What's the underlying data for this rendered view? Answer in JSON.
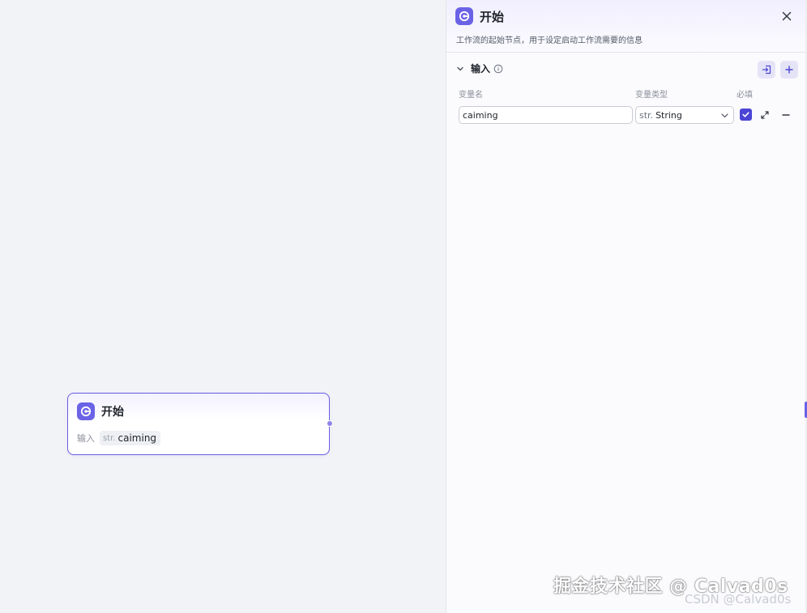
{
  "canvas": {
    "node": {
      "title": "开始",
      "input_label": "输入",
      "variable": {
        "type_prefix": "str.",
        "name": "caiming"
      }
    }
  },
  "panel": {
    "title": "开始",
    "description": "工作流的起始节点，用于设定启动工作流需要的信息",
    "section": {
      "title": "输入",
      "columns": {
        "name": "变量名",
        "type": "变量类型",
        "required": "必填"
      },
      "row": {
        "name_value": "caiming",
        "type_prefix": "str.",
        "type_value": "String",
        "required": true
      }
    }
  },
  "watermark": {
    "main": "掘金技术社区 @ Calvad0s",
    "sub": "CSDN @Calvad0s"
  },
  "icons": {
    "node_icon": "start-logo-icon",
    "close": "close-icon",
    "chevron": "chevron-down-icon",
    "info": "info-icon",
    "import": "import-icon",
    "add": "plus-icon",
    "expand": "expand-icon",
    "remove": "minus-icon"
  },
  "colors": {
    "accent": "#6b63e6",
    "checkbox": "#4b45d6",
    "node_border": "#6a5ce0"
  }
}
